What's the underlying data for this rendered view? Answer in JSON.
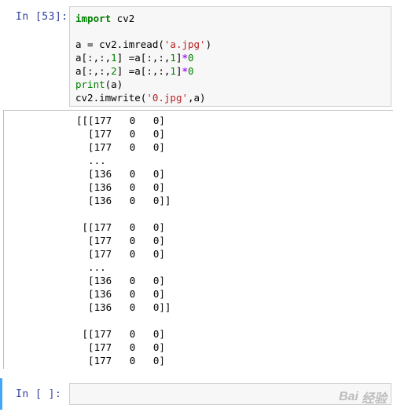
{
  "cell1": {
    "prompt": "In  [53]:",
    "code": {
      "l1_kw": "import",
      "l1_rest": " cv2",
      "l2": "a = cv2.imread(",
      "l2_str": "'a.jpg'",
      "l2_end": ")",
      "l3a": "a[:,:,",
      "l3_n1": "1",
      "l3b": "] =a[:,:,",
      "l3_n2": "1",
      "l3c": "]",
      "l3_op": "*",
      "l3_n3": "0",
      "l4a": "a[:,:,",
      "l4_n1": "2",
      "l4b": "] =a[:,:,",
      "l4_n2": "1",
      "l4c": "]",
      "l4_op": "*",
      "l4_n3": "0",
      "l5_fn": "print",
      "l5_rest": "(a)",
      "l6": "cv2.imwrite(",
      "l6_str": "'0.jpg'",
      "l6_end": ",a)"
    },
    "output": [
      "[[[177   0   0]",
      "  [177   0   0]",
      "  [177   0   0]",
      "  ...",
      "  [136   0   0]",
      "  [136   0   0]",
      "  [136   0   0]]",
      "",
      " [[177   0   0]",
      "  [177   0   0]",
      "  [177   0   0]",
      "  ...",
      "  [136   0   0]",
      "  [136   0   0]",
      "  [136   0   0]]",
      "",
      " [[177   0   0]",
      "  [177   0   0]",
      "  [177   0   0]"
    ]
  },
  "cell2": {
    "prompt": "In  [ ]:",
    "value": ""
  },
  "watermark": {
    "brand": "Bai",
    "brand2": "经验",
    "sub": "jingyan.baidu.com"
  },
  "colors": {
    "prompt": "#303f9f",
    "keyword": "#008000",
    "string": "#ba2121",
    "operator": "#aa22ff",
    "selection": "#42a5f5"
  }
}
